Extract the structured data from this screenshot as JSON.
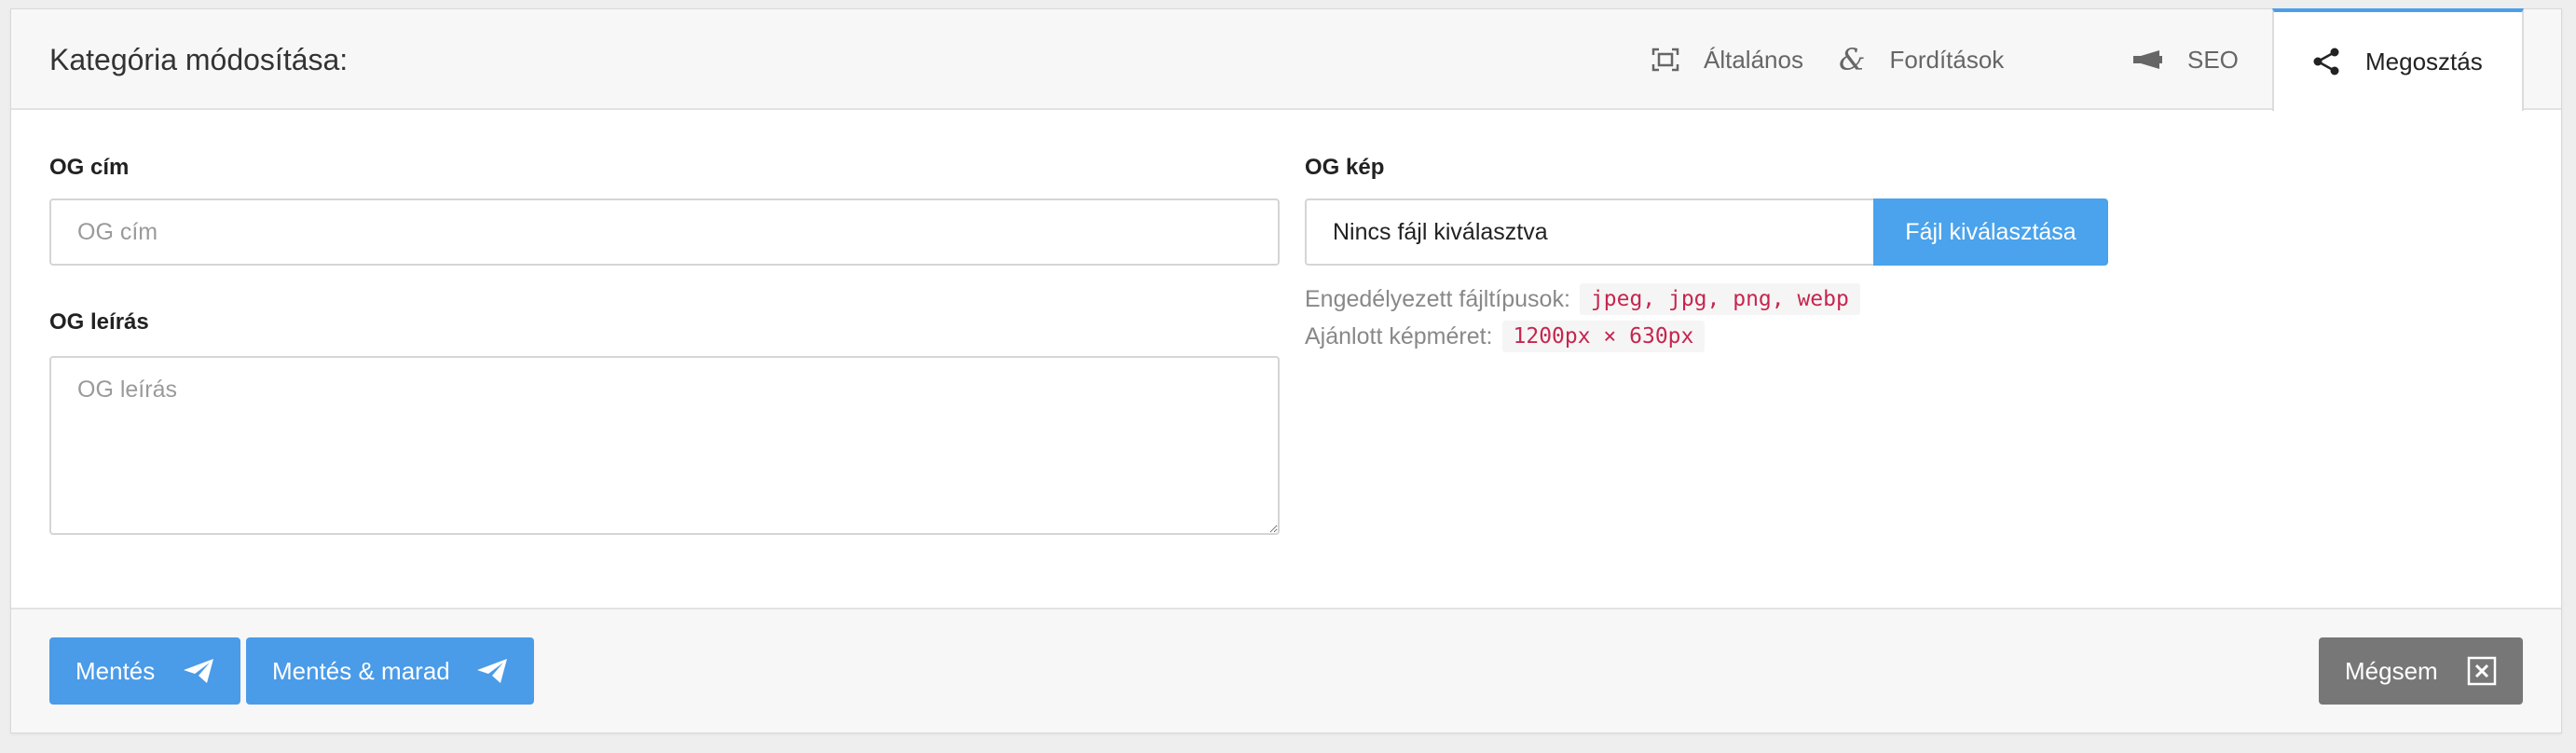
{
  "header": {
    "title": "Kategória módosítása:",
    "tabs": [
      {
        "label": "Általános",
        "icon": "expand-frame-icon"
      },
      {
        "label": "Fordítások",
        "icon": "ampersand-icon"
      },
      {
        "label": "SEO",
        "icon": "megaphone-icon"
      },
      {
        "label": "Megosztás",
        "icon": "share-icon",
        "active": true
      }
    ]
  },
  "form": {
    "og_title": {
      "label": "OG cím",
      "placeholder": "OG cím",
      "value": ""
    },
    "og_description": {
      "label": "OG leírás",
      "placeholder": "OG leírás",
      "value": ""
    },
    "og_image": {
      "label": "OG kép",
      "file_name": "Nincs fájl kiválasztva",
      "button_label": "Fájl kiválasztása",
      "allowed_types_label": "Engedélyezett fájltípusok:",
      "allowed_types": "jpeg, jpg, png, webp",
      "recommended_size_label": "Ajánlott képméret:",
      "recommended_size": "1200px × 630px"
    }
  },
  "footer": {
    "save_label": "Mentés",
    "save_stay_label": "Mentés & marad",
    "cancel_label": "Mégsem"
  },
  "colors": {
    "accent": "#4a9fe8",
    "primary_button": "#4a9be8",
    "cancel_button": "#777777",
    "code_text": "#c7254e"
  }
}
